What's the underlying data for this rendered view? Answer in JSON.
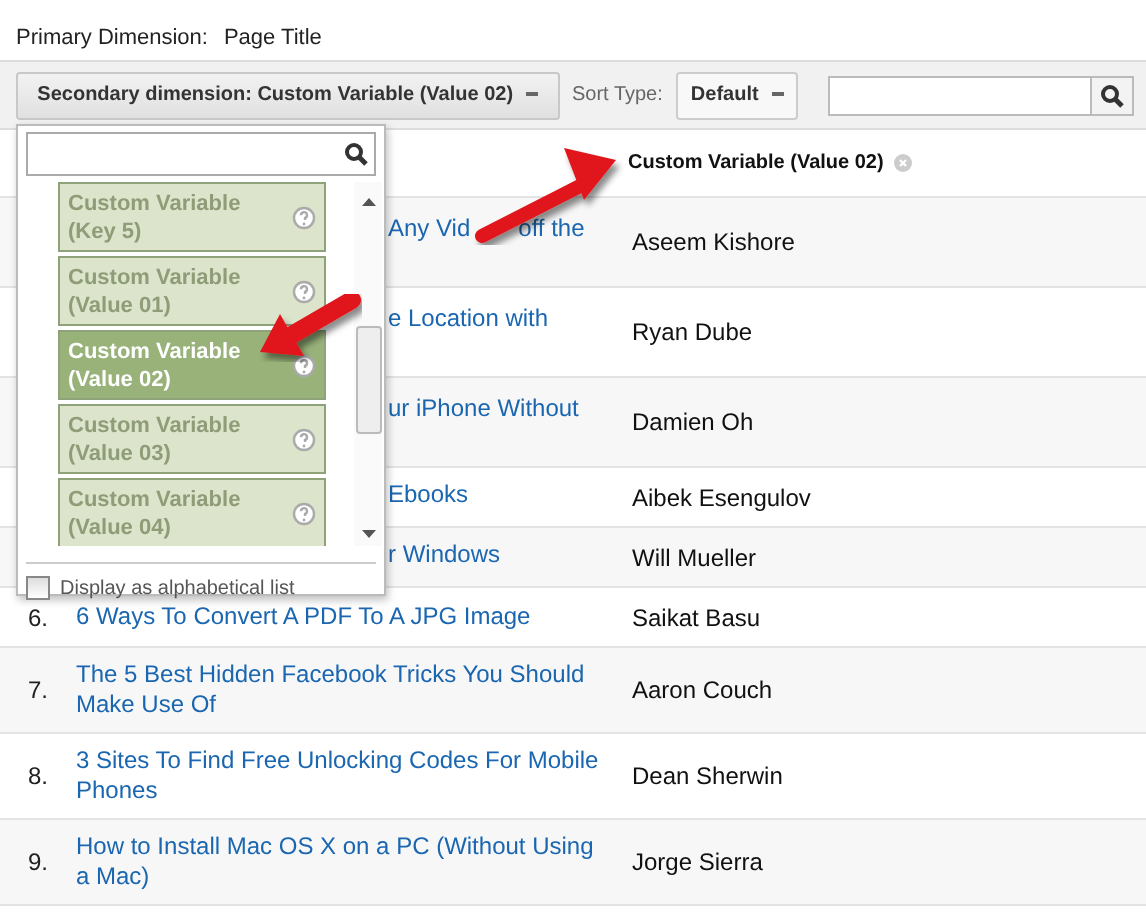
{
  "primary_dimension": {
    "label": "Primary Dimension:",
    "value": "Page Title"
  },
  "toolbar": {
    "secondary_button": "Secondary dimension: Custom Variable (Value 02)",
    "sort_label": "Sort Type:",
    "sort_value": "Default"
  },
  "dropdown": {
    "items": [
      {
        "label": "Custom Variable (Key 5)",
        "selected": false
      },
      {
        "label": "Custom Variable (Value 01)",
        "selected": false
      },
      {
        "label": "Custom Variable (Value 02)",
        "selected": true
      },
      {
        "label": "Custom Variable (Value 03)",
        "selected": false
      },
      {
        "label": "Custom Variable (Value 04)",
        "selected": false
      }
    ],
    "alphabetical": {
      "label": "Display as alphabetical list",
      "checked": false
    }
  },
  "table": {
    "column_header": "Custom Variable (Value 02)",
    "rows": [
      {
        "title": "Any Vid",
        "title_tail": "off the",
        "author": "Aseem Kishore"
      },
      {
        "title": "e Location with",
        "author": "Ryan Dube"
      },
      {
        "title": "ur iPhone Without",
        "author": "Damien Oh"
      },
      {
        "title": "Ebooks",
        "author": "Aibek Esengulov"
      },
      {
        "title": "r Windows",
        "author": "Will Mueller"
      },
      {
        "number": "6.",
        "title": "6 Ways To Convert A PDF To A JPG Image",
        "author": "Saikat Basu"
      },
      {
        "number": "7.",
        "title": "The 5 Best Hidden Facebook Tricks You Should Make Use Of",
        "author": "Aaron Couch"
      },
      {
        "number": "8.",
        "title": "3 Sites To Find Free Unlocking Codes For Mobile Phones",
        "author": "Dean Sherwin"
      },
      {
        "number": "9.",
        "title": "How to Install Mac OS X on a PC (Without Using a Mac)",
        "author": "Jorge Sierra"
      }
    ]
  }
}
